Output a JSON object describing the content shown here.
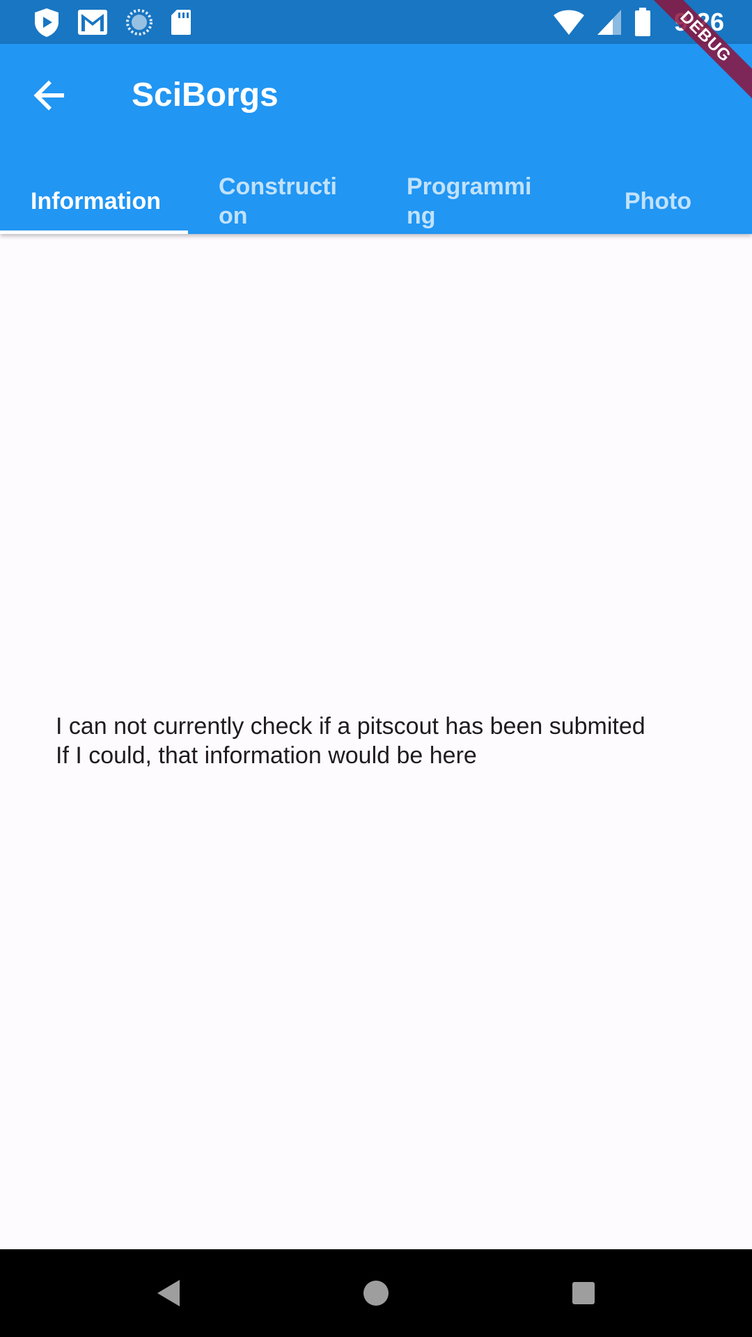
{
  "status_bar": {
    "time": "9:26",
    "left_icons": [
      "play-protect-icon",
      "gmail-icon",
      "sync-icon",
      "sd-card-icon"
    ],
    "right_icons": [
      "wifi-icon",
      "signal-icon",
      "battery-icon"
    ]
  },
  "debug_banner": {
    "label": "DEBUG"
  },
  "app_bar": {
    "title": "SciBorgs",
    "back_icon": "arrow-back-icon",
    "background_color": "#2196f3"
  },
  "tabs": [
    {
      "label": "Information",
      "active": true
    },
    {
      "label": "Construction",
      "active": false
    },
    {
      "label": "Programming",
      "active": false
    },
    {
      "label": "Photo",
      "active": false
    }
  ],
  "content": {
    "line1": "I can not currently check if a pitscout has been submited",
    "line2": "If I could, that information would be here"
  },
  "nav_bar": {
    "buttons": [
      "back-triangle-icon",
      "home-circle-icon",
      "recents-square-icon"
    ]
  }
}
